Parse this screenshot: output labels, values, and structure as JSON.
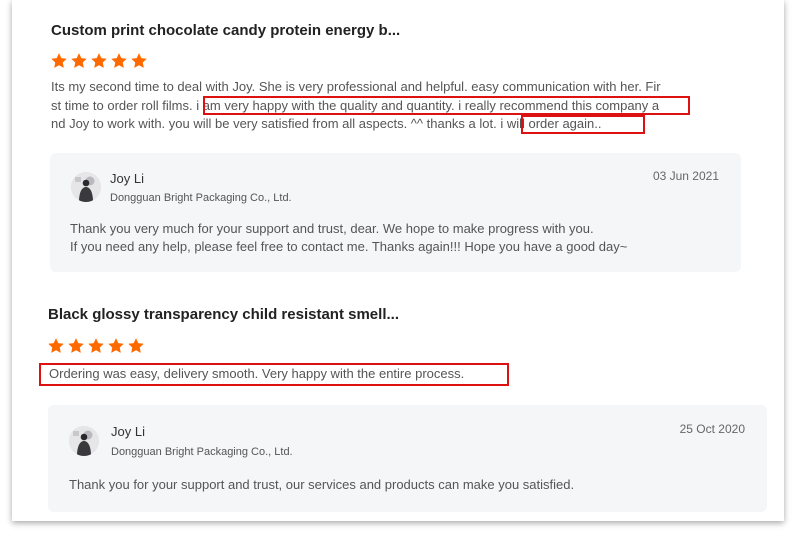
{
  "reviews": [
    {
      "product_title": "Custom print chocolate candy protein energy b...",
      "rating": 5,
      "text_lines": [
        "Its my second time to deal with Joy. She is very professional and helpful. easy communication with her. Fir",
        "st time to order roll films. i am very happy with the quality and quantity. i really recommend this company a",
        "nd Joy to work with. you will be very satisfied from all aspects. ^^ thanks a lot. i will order again.."
      ],
      "reply": {
        "name": "Joy Li",
        "company": "Dongguan Bright Packaging Co., Ltd.",
        "date": "03 Jun 2021",
        "text_lines": [
          "Thank you very much for your support and trust, dear. We hope to make progress with you.",
          "If you need any help, please feel free to contact me. Thanks again!!! Hope you have a good day~"
        ]
      }
    },
    {
      "product_title": "Black glossy transparency child resistant smell...",
      "rating": 5,
      "text_lines": [
        "Ordering was easy, delivery smooth. Very happy with the entire process."
      ],
      "reply": {
        "name": "Joy Li",
        "company": "Dongguan Bright Packaging Co., Ltd.",
        "date": "25 Oct 2020",
        "text_lines": [
          "Thank you for your support and trust, our services and products can make you satisfied."
        ]
      }
    }
  ],
  "colors": {
    "star": "#ff6a00",
    "highlight_box": "#dd1111",
    "reply_bg": "#f5f6f8"
  },
  "icons": {
    "star": "star-icon",
    "avatar": "avatar-icon"
  }
}
